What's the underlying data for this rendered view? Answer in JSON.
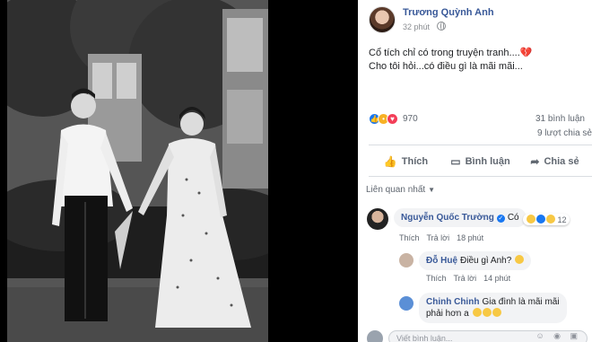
{
  "post": {
    "author": "Trương Quỳnh Anh",
    "time": "32 phút",
    "text_line1": "Cổ tích chỉ có trong truyện tranh....",
    "text_line1_emoji": "💔",
    "text_line2": "Cho tôi hỏi...có điều gì là mãi mãi...",
    "reaction_count": "970",
    "comments_count": "31 bình luận",
    "shares_count": "9 lượt chia sẻ"
  },
  "actions": {
    "like": "Thích",
    "comment": "Bình luận",
    "share": "Chia sẻ"
  },
  "sort": {
    "label": "Liên quan nhất"
  },
  "comments": [
    {
      "name": "Nguyễn Quốc Trường",
      "text": "Có",
      "reaction_count": "12",
      "like": "Thích",
      "reply": "Trả lời",
      "time": "18 phút"
    },
    {
      "name": "Đỗ Huệ",
      "text": "Điều gì Anh?",
      "like": "Thích",
      "reply": "Trả lời",
      "time": "14 phút"
    },
    {
      "name": "Chinh Chinh",
      "text_line1": "Gia đình là mãi mãi",
      "text_line2": "phải hơn a"
    }
  ],
  "composer": {
    "placeholder": "Viết bình luận..."
  },
  "colors": {
    "link_blue": "#385898",
    "fb_blue": "#1877f2",
    "secondary_text": "#606770"
  },
  "icons": [
    "globe-icon",
    "like-icon",
    "sad-icon",
    "love-icon",
    "thumbs-up-icon",
    "comment-icon",
    "share-icon",
    "verified-icon",
    "emoji-icon"
  ]
}
